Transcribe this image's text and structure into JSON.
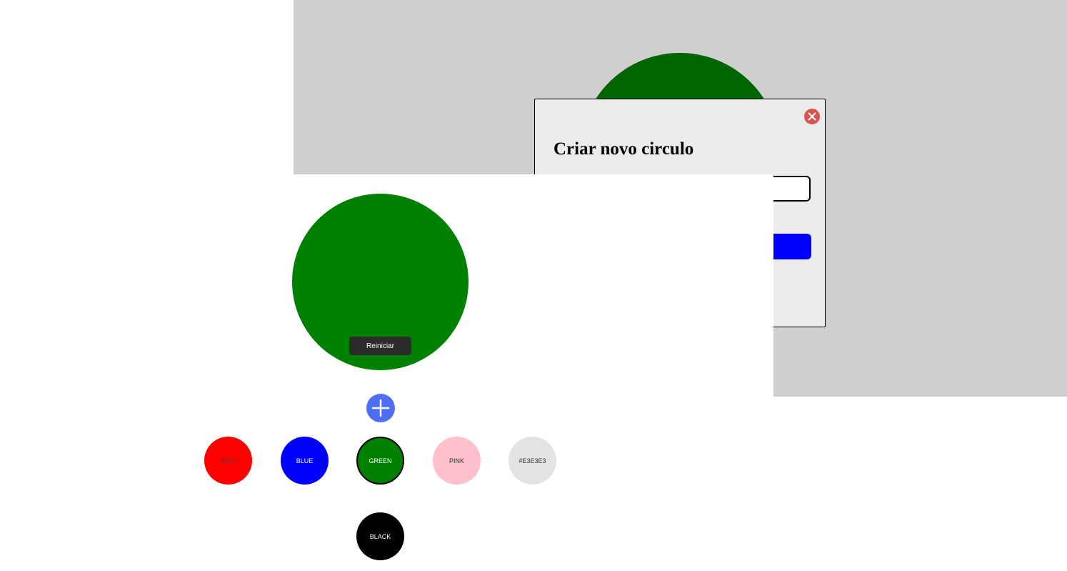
{
  "modal": {
    "title": "Criar novo circulo",
    "input_value": "",
    "input_placeholder": "",
    "submit_label": "",
    "close_icon": "close-icon",
    "close_color": "#d9534f",
    "submit_color": "#0000ff"
  },
  "main_circle": {
    "color": "#008000",
    "reset_label": "Reiniciar"
  },
  "add_button": {
    "icon": "plus-icon",
    "color": "#4d6ef5"
  },
  "swatches": [
    {
      "label": "RED",
      "color": "#ff0000",
      "text_color": "#444444",
      "selected": false
    },
    {
      "label": "BLUE",
      "color": "#0000ff",
      "text_color": "#ffffff",
      "selected": false
    },
    {
      "label": "GREEN",
      "color": "#008000",
      "text_color": "#ffffff",
      "selected": true
    },
    {
      "label": "PINK",
      "color": "#ffc0cb",
      "text_color": "#333333",
      "selected": false
    },
    {
      "label": "#E3E3E3",
      "color": "#e3e3e3",
      "text_color": "#333333",
      "selected": false
    },
    {
      "label": "BLACK",
      "color": "#000000",
      "text_color": "#ffffff",
      "selected": false
    }
  ],
  "overlay": {
    "color": "#cfcfcf",
    "circle_color": "#006400"
  }
}
